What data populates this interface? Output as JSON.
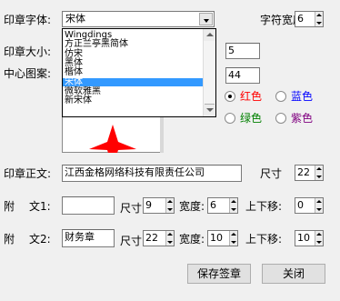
{
  "labels": {
    "seal_font": "印章字体:",
    "char_width": "字符宽度:",
    "seal_size": "印章大小:",
    "center_pattern": "中心图案:",
    "seal_text": "印章正文:",
    "size1": "尺寸",
    "attach1": "附",
    "attach1_b": "文1:",
    "size2": "尺寸",
    "width2": "宽度:",
    "shift2": "上下移:",
    "attach2": "附",
    "attach2_b": "文2:",
    "size3": "尺寸",
    "width3": "宽度:",
    "shift3": "上下移:"
  },
  "font_combo": {
    "value": "宋体"
  },
  "font_dropdown": {
    "items": [
      "Wingdings",
      "方正兰亭黑简体",
      "仿宋",
      "黑体",
      "楷体",
      "宋体",
      "微软雅黑",
      "新宋体"
    ],
    "selected_index": 5
  },
  "fields": {
    "char_width": "6",
    "seal_size": "5",
    "pattern_size": "44",
    "seal_text": "江西金格网络科技有限责任公司",
    "seal_text_size": "22",
    "attach1_text": "",
    "attach1_size": "9",
    "attach1_width": "6",
    "attach1_shift": "0",
    "attach2_text": "财务章",
    "attach2_size": "22",
    "attach2_width": "10",
    "attach2_shift": "10"
  },
  "colors": {
    "options": [
      {
        "label": "红色",
        "color": "#ff0000",
        "selected": true
      },
      {
        "label": "蓝色",
        "color": "#0000ff",
        "selected": false
      },
      {
        "label": "绿色",
        "color": "#008000",
        "selected": false
      },
      {
        "label": "紫色",
        "color": "#800080",
        "selected": false
      }
    ],
    "preview_star": "#ff0000"
  },
  "buttons": {
    "save": "保存签章",
    "close": "关闭"
  }
}
